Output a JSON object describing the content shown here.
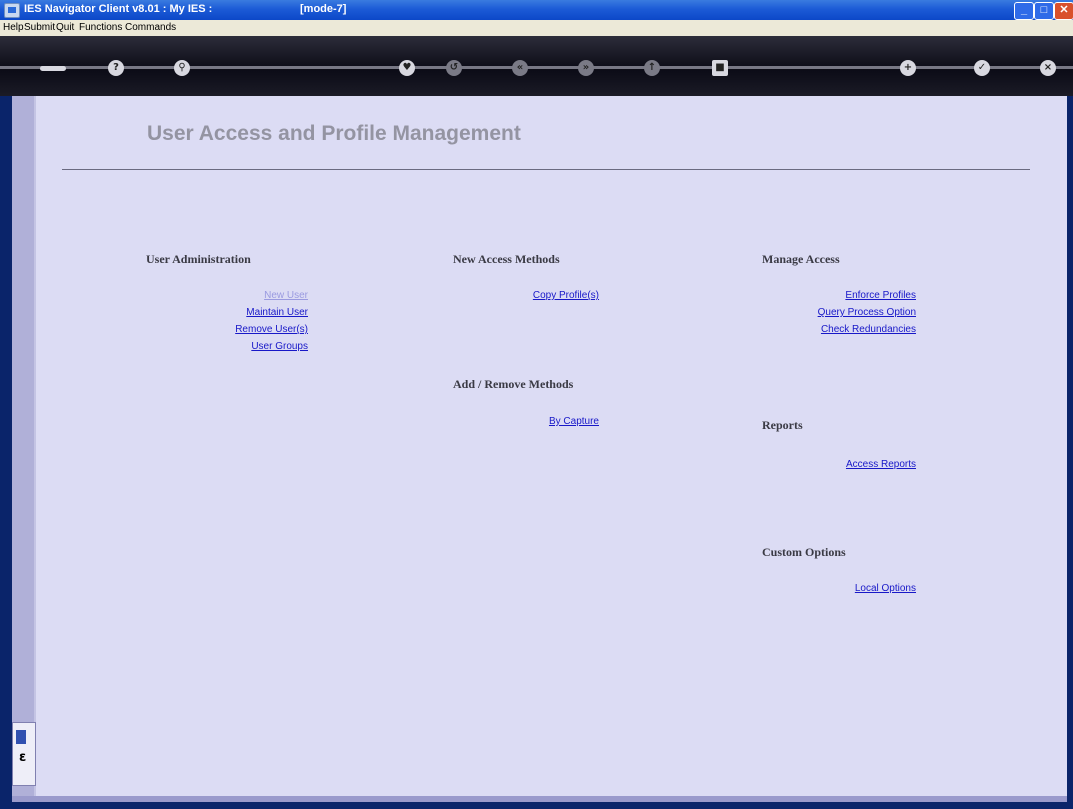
{
  "window": {
    "title": "IES Navigator Client v8.01 : My IES :",
    "mode": "[mode-7]"
  },
  "menu": {
    "items": [
      "Help",
      "Submit",
      "Quit",
      "Functions",
      "Commands"
    ]
  },
  "page": {
    "title": "User Access and Profile Management"
  },
  "sections": {
    "user_admin": {
      "heading": "User Administration",
      "links": [
        "New User",
        "Maintain User",
        "Remove User(s)",
        "User Groups"
      ]
    },
    "new_access": {
      "heading": "New Access Methods",
      "links": [
        "Copy Profile(s)"
      ]
    },
    "add_remove": {
      "heading": "Add / Remove Methods",
      "links": [
        "By Capture"
      ]
    },
    "manage_access": {
      "heading": "Manage Access",
      "links": [
        "Enforce Profiles",
        "Query Process Option",
        "Check Redundancies"
      ]
    },
    "reports": {
      "heading": "Reports",
      "links": [
        "Access Reports"
      ]
    },
    "custom": {
      "heading": "Custom Options",
      "links": [
        "Local Options"
      ]
    }
  },
  "toolbar": {
    "icons": [
      "key-icon",
      "help-icon",
      "search-icon",
      "heart-icon",
      "undo-icon",
      "back-icon",
      "forward-icon",
      "up-icon",
      "stop-icon",
      "add-icon",
      "check-icon",
      "close-icon"
    ]
  },
  "colors": {
    "titlebar": "#0c47c8",
    "panel": "#dcdcf4",
    "link": "#1818c8",
    "link_visited": "#9a9ae0",
    "heading": "#3a3a44"
  }
}
